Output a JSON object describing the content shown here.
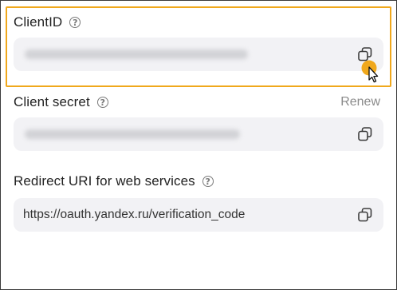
{
  "client_id": {
    "label": "ClientID",
    "help": "?"
  },
  "client_secret": {
    "label": "Client secret",
    "help": "?",
    "renew_label": "Renew"
  },
  "redirect_uri": {
    "label": "Redirect URI for web services",
    "help": "?",
    "value": "https://oauth.yandex.ru/verification_code"
  },
  "colors": {
    "highlight": "#f0a81c",
    "field_bg": "#f2f2f5",
    "cursor_dot": "#f0a81c"
  },
  "icons": [
    "question-circle-icon",
    "copy-icon",
    "mouse-pointer-icon"
  ]
}
